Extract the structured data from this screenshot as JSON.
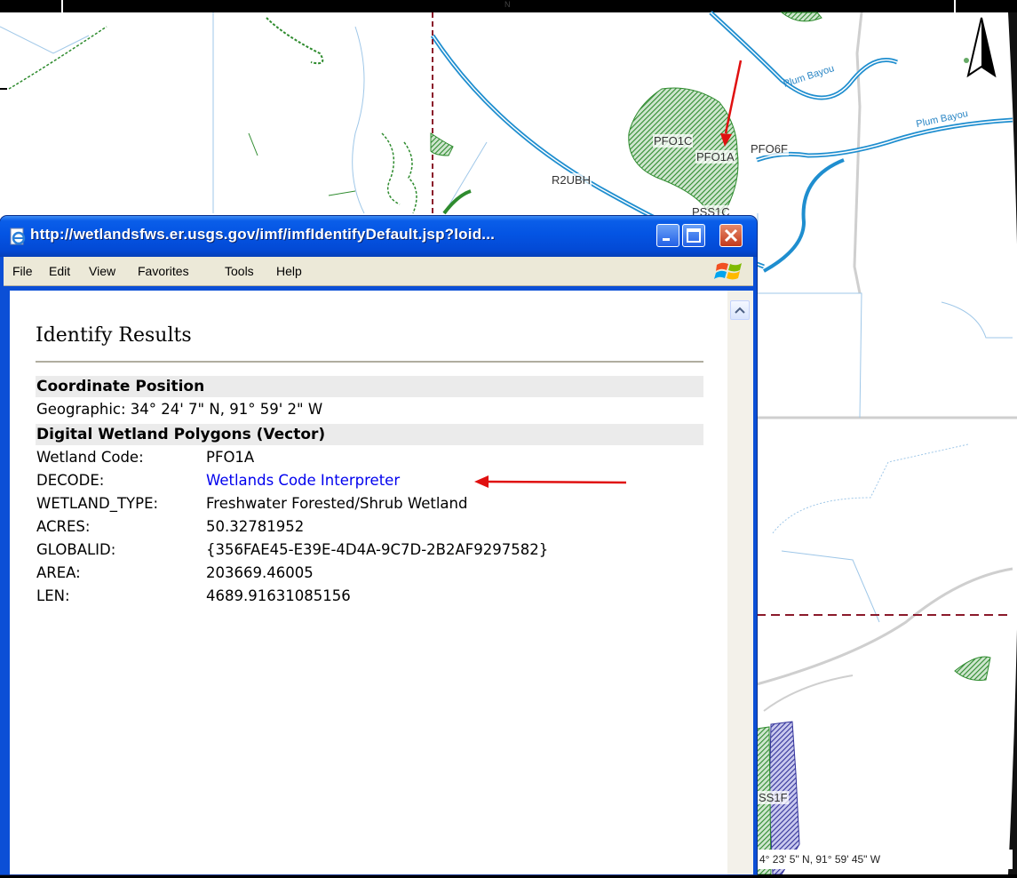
{
  "map": {
    "north_letter": "N",
    "labels": {
      "pfo1c": "PFO1C",
      "pfo1a": "PFO1A",
      "pfo6f": "PFO6F",
      "r2ubh": "R2UBH",
      "pss1c": "PSS1C",
      "ss1f": "SS1F",
      "plum_bayou_1": "Plum Bayou",
      "plum_bayou_2": "Plum Bayou"
    },
    "coords_text": "4° 23' 5\" N, 91° 59' 45\" W"
  },
  "window": {
    "title": "http://wetlandsfws.er.usgs.gov/imf/imfIdentifyDefault.jsp?loid...",
    "menu": [
      "File",
      "Edit",
      "View",
      "Favorites",
      "Tools",
      "Help"
    ]
  },
  "results": {
    "title": "Identify Results",
    "coordinate": {
      "header": "Coordinate Position",
      "line": "Geographic: 34° 24' 7\" N, 91° 59' 2\" W"
    },
    "polygons": {
      "header": "Digital Wetland Polygons (Vector)",
      "rows": [
        {
          "key": "Wetland Code:",
          "value": "PFO1A"
        },
        {
          "key": "DECODE:",
          "value": "Wetlands Code Interpreter"
        },
        {
          "key": "WETLAND_TYPE:",
          "value": "Freshwater Forested/Shrub Wetland"
        },
        {
          "key": "ACRES:",
          "value": "50.32781952"
        },
        {
          "key": "GLOBALID:",
          "value": "{356FAE45-E39E-4D4A-9C7D-2B2AF9297582}"
        },
        {
          "key": "AREA:",
          "value": "203669.46005"
        },
        {
          "key": "LEN:",
          "value": "4689.91631085156"
        }
      ]
    }
  },
  "colors": {
    "river": "#1f8ecf",
    "wetland": "#2e8b2e",
    "boundary": "#8b1a2b",
    "link": "#0000ee",
    "arrow": "#e01010"
  }
}
